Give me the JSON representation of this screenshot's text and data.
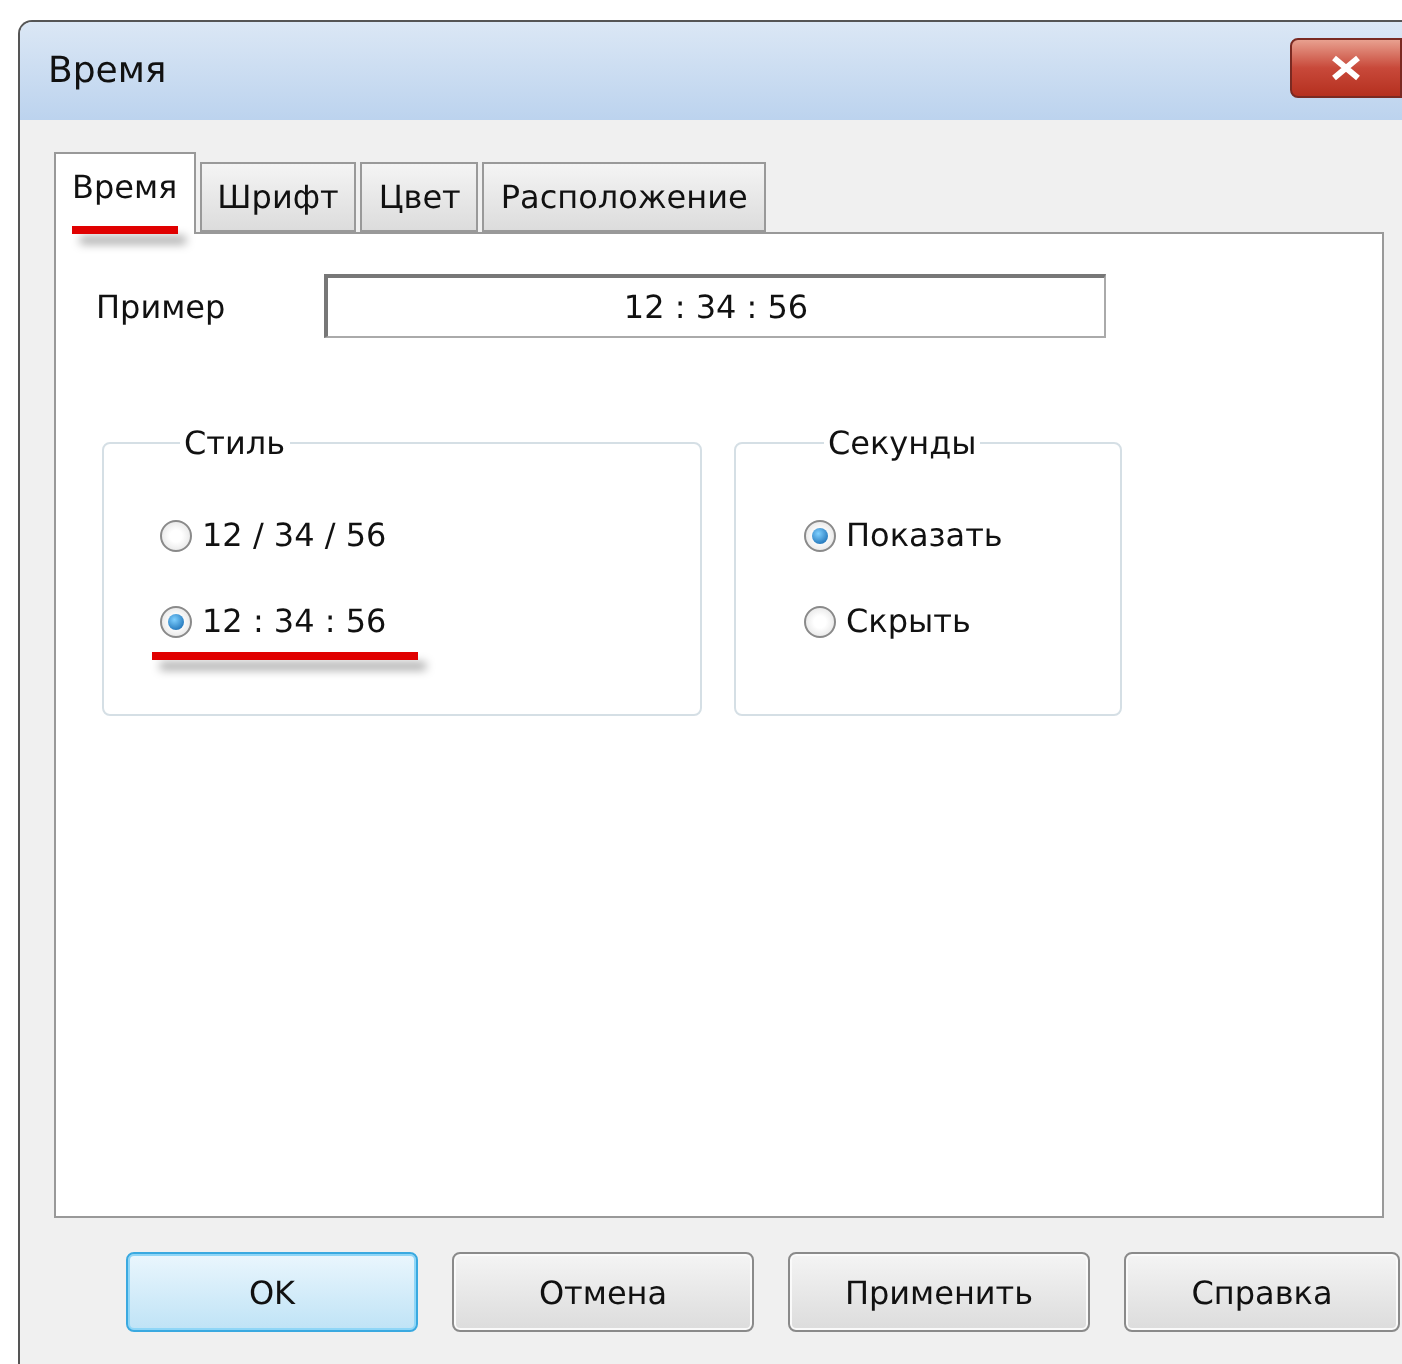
{
  "window": {
    "title": "Время"
  },
  "tabs": [
    {
      "label": "Время",
      "selected": true,
      "underlined": true
    },
    {
      "label": "Шрифт",
      "selected": false,
      "underlined": false
    },
    {
      "label": "Цвет",
      "selected": false,
      "underlined": false
    },
    {
      "label": "Расположение",
      "selected": false,
      "underlined": false
    }
  ],
  "example": {
    "label": "Пример",
    "value": "12 : 34 : 56"
  },
  "groups": [
    {
      "title": "Стиль",
      "options": [
        {
          "label": "12 / 34 / 56",
          "selected": false,
          "underlined": false
        },
        {
          "label": "12 : 34 : 56",
          "selected": true,
          "underlined": true
        }
      ]
    },
    {
      "title": "Секунды",
      "options": [
        {
          "label": "Показать",
          "selected": true,
          "underlined": false
        },
        {
          "label": "Скрыть",
          "selected": false,
          "underlined": false
        }
      ]
    }
  ],
  "buttons": [
    {
      "label": "OK",
      "default": true
    },
    {
      "label": "Отмена",
      "default": false
    },
    {
      "label": "Применить",
      "default": false
    },
    {
      "label": "Справка",
      "default": false
    }
  ]
}
